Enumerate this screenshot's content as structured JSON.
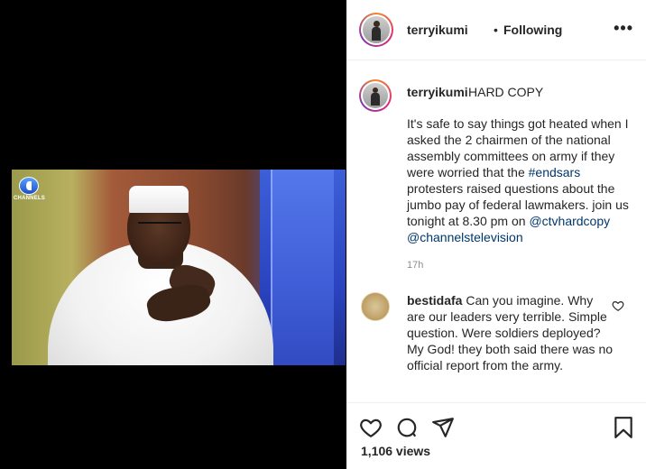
{
  "post": {
    "username": "terryikumi",
    "separator": "•",
    "follow_status": "Following",
    "more_label": "•••",
    "channel_logo_text": "CHANNELS"
  },
  "caption": {
    "username": "terryikumi",
    "title": "HARD COPY",
    "text_1": "It's safe to say things got heated when I asked the 2 chairmen of the national assembly committees on army if they were worried that the ",
    "hashtag": "#endsars",
    "text_2": " protesters raised questions about the jumbo pay of federal lawmakers. join us tonight at 8.30 pm on ",
    "mention_1": "@ctvhardcopy",
    "space": " ",
    "mention_2": "@channelstelevision",
    "time": "17h"
  },
  "comment": {
    "username": "bestidafa",
    "text": " Can you imagine. Why are our leaders very terrible. Simple question. Were soldiers deployed? My God! they both said there was no official report from the army."
  },
  "stats": {
    "views": "1,106 views"
  },
  "icons": [
    "heart-icon",
    "comment-icon",
    "share-icon",
    "bookmark-icon",
    "more-icon",
    "like-comment-icon"
  ]
}
